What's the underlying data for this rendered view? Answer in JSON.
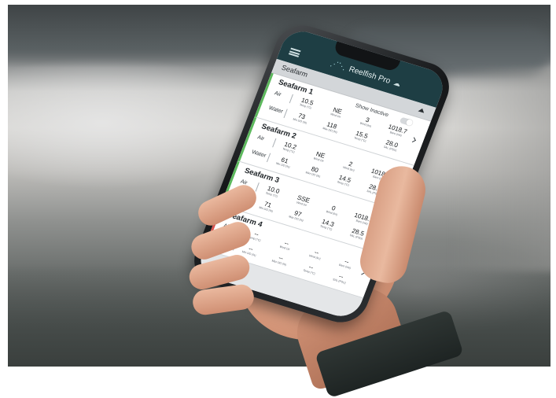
{
  "app": {
    "brand": "Reelfish Pro",
    "section": "Seafarm",
    "show_inactive_label": "Show Inactive",
    "air_label": "Air",
    "water_label": "Water"
  },
  "farms": [
    {
      "name": "Seafarm 1",
      "status": "active",
      "air": [
        {
          "v": "10.5",
          "u": "Temp (°C)"
        },
        {
          "v": "NE",
          "u": "Wind Dir"
        },
        {
          "v": "3",
          "u": "Wind (kn)"
        },
        {
          "v": "1018.7",
          "u": "Baro (mb)"
        }
      ],
      "water": [
        {
          "v": "73",
          "u": "Min DO (%)"
        },
        {
          "v": "118",
          "u": "Max DO (%)"
        },
        {
          "v": "15.5",
          "u": "Temp (°C)"
        },
        {
          "v": "28.0",
          "u": "SAL (PSU)"
        }
      ]
    },
    {
      "name": "Seafarm 2",
      "status": "active",
      "air": [
        {
          "v": "10.2",
          "u": "Temp (°C)"
        },
        {
          "v": "NE",
          "u": "Wind Dir"
        },
        {
          "v": "2",
          "u": "Wind (kn)"
        },
        {
          "v": "1018.2",
          "u": "Baro (mb)"
        }
      ],
      "water": [
        {
          "v": "61",
          "u": "Min DO (%)"
        },
        {
          "v": "80",
          "u": "Max DO (%)"
        },
        {
          "v": "14.5",
          "u": "Temp (°C)"
        },
        {
          "v": "28.5",
          "u": "SAL (PSU)"
        }
      ]
    },
    {
      "name": "Seafarm 3",
      "status": "active",
      "air": [
        {
          "v": "10.0",
          "u": "Temp (°C)"
        },
        {
          "v": "SSE",
          "u": "Wind Dir"
        },
        {
          "v": "0",
          "u": "Wind (kn)"
        },
        {
          "v": "1018.1",
          "u": "Baro (mb)"
        }
      ],
      "water": [
        {
          "v": "71",
          "u": "Min DO (%)"
        },
        {
          "v": "97",
          "u": "Max DO (%)"
        },
        {
          "v": "14.3",
          "u": "Temp (°C)"
        },
        {
          "v": "28.5",
          "u": "SAL (PSU)"
        }
      ]
    },
    {
      "name": "Seafarm 4",
      "status": "inactive",
      "air": [
        {
          "v": "--",
          "u": "Temp (°C)"
        },
        {
          "v": "--",
          "u": "Wind Dir"
        },
        {
          "v": "--",
          "u": "Wind (kn)"
        },
        {
          "v": "--",
          "u": "Baro (mb)"
        }
      ],
      "water": [
        {
          "v": "--",
          "u": "Min DO (%)"
        },
        {
          "v": "--",
          "u": "Max DO (%)"
        },
        {
          "v": "--",
          "u": "Temp (°C)"
        },
        {
          "v": "--",
          "u": "SAL (PSU)"
        }
      ]
    }
  ],
  "colors": {
    "header": "#1e3e44",
    "active_border": "#5cb85c",
    "inactive_border": "#d9534f"
  },
  "icons": {
    "menu": "menu-icon",
    "logo": "fish-logo-icon",
    "cloud": "cloud-icon",
    "collapse": "chevron-up-icon",
    "row": "chevron-right-icon"
  }
}
